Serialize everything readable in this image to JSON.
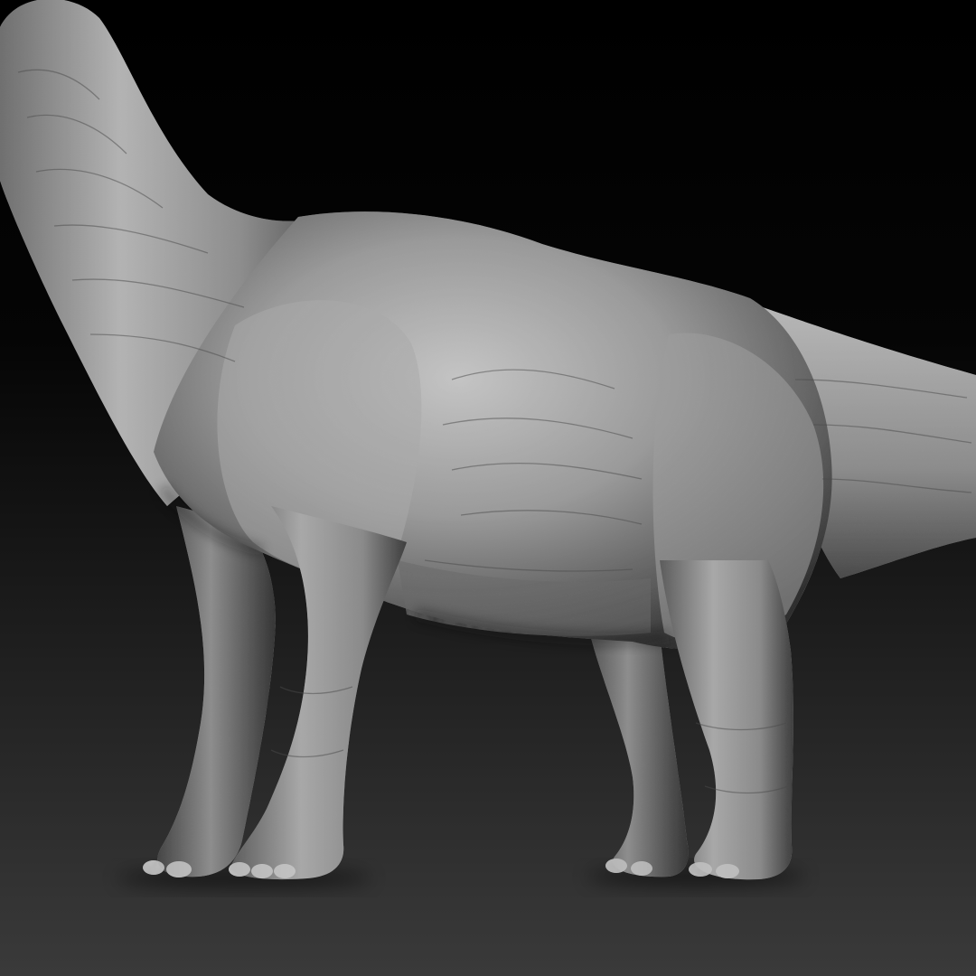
{
  "scene": {
    "subject": "sauropod-sculpt",
    "material": "matcap-gray",
    "colors": {
      "background_top": "#000000",
      "background_bottom": "#3a3a3a",
      "skin_light": "#bdbdbd",
      "skin_mid": "#8a8a8a",
      "skin_dark": "#3d3d3d"
    }
  }
}
